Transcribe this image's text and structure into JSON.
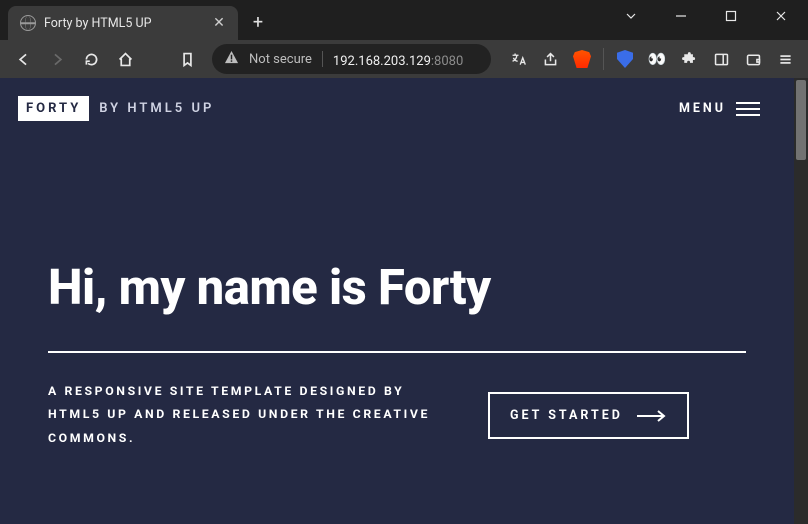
{
  "browser": {
    "tab_title": "Forty by HTML5 UP",
    "new_tab_label": "+",
    "address": {
      "security_label": "Not secure",
      "host": "192.168.203.129",
      "port": ":8080"
    }
  },
  "site": {
    "logo": {
      "strong": "FORTY",
      "by": "BY HTML5 UP"
    },
    "menu_label": "MENU"
  },
  "hero": {
    "headline": "Hi, my name is Forty",
    "description": "A RESPONSIVE SITE TEMPLATE DESIGNED BY HTML5 UP AND RELEASED UNDER THE CREATIVE COMMONS.",
    "cta_label": "GET STARTED"
  }
}
